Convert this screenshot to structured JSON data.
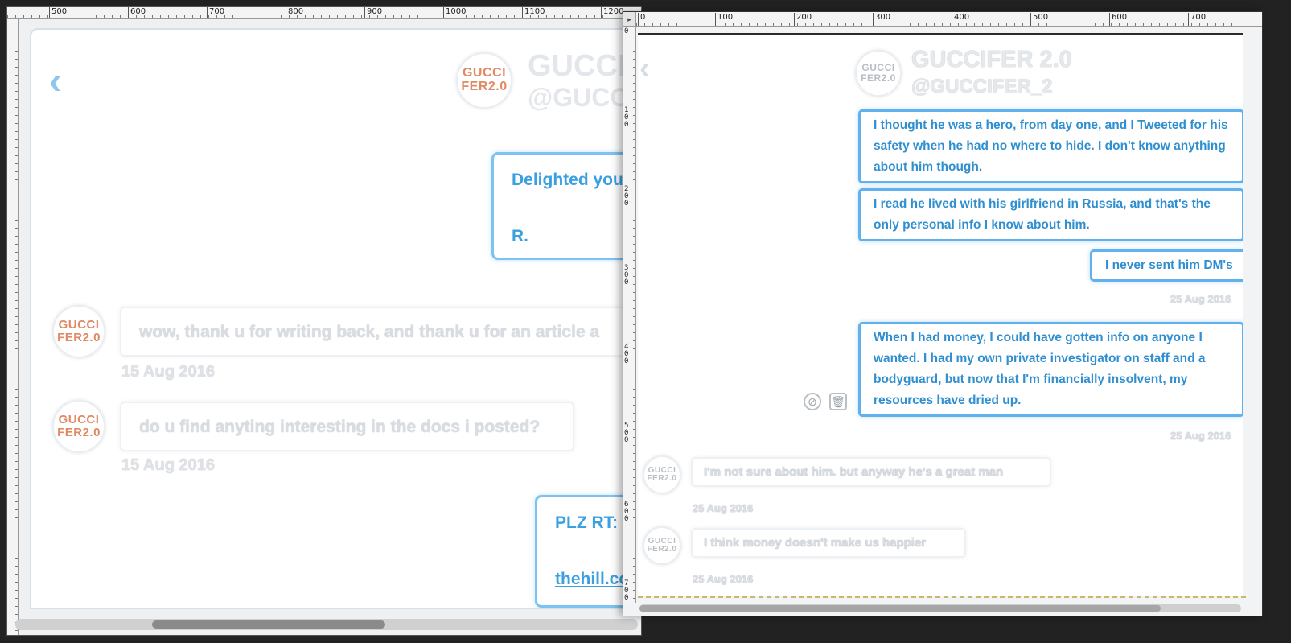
{
  "left": {
    "ruler_marks": [
      "500",
      "600",
      "700",
      "800",
      "900",
      "1000",
      "1100",
      "1200"
    ],
    "header": {
      "name": "GUCCI",
      "handle": "@GUCCI"
    },
    "avatar_text": [
      "GUCCI",
      "FER2.0"
    ],
    "messages": {
      "out1_line1": "Delighted you",
      "out1_line2": "R.",
      "in1_text": "wow, thank u for writing back, and thank u for an article a",
      "in1_date": "15 Aug 2016",
      "in2_text": "do u find anyting interesting in the docs i posted?",
      "in2_date": "15 Aug 2016",
      "out2_line1": "PLZ RT:",
      "out2_link": "thehill.co"
    }
  },
  "right": {
    "ruler_marks": [
      "0",
      "100",
      "200",
      "300",
      "400",
      "500",
      "600",
      "700"
    ],
    "ruler_left_marks": [
      "0",
      "100",
      "200",
      "300",
      "400",
      "500",
      "600",
      "700"
    ],
    "header": {
      "name": "GUCCIFER 2.0",
      "handle": "@GUCCIFER_2"
    },
    "avatar_text": [
      "GUCCI",
      "FER2.0"
    ],
    "messages": {
      "out1": "I thought he was a hero, from day one, and I Tweeted for his safety when he had no where to hide. I don't know anything about him though.",
      "out2": "I read he lived with his girlfriend in Russia, and that's the only personal info I know about him.",
      "out3": "I never sent him DM's",
      "date1": "25 Aug 2016",
      "out4": "When I had money, I could have gotten info on anyone I wanted. I had my own private investigator on staff and a bodyguard, but now that I'm financially insolvent, my resources have dried up.",
      "date2": "25 Aug 2016",
      "in1_text": "I'm not sure about him. but anyway he's a great man",
      "in1_date": "25 Aug 2016",
      "in2_text": "I think money doesn't make us happier",
      "in2_date": "25 Aug 2016"
    }
  },
  "colors": {
    "accent": "#3aa0e0",
    "avatar_text": "#e08a64"
  },
  "icons": {
    "back": "chevron-left-icon",
    "block": "block-icon",
    "delete": "trash-icon"
  }
}
